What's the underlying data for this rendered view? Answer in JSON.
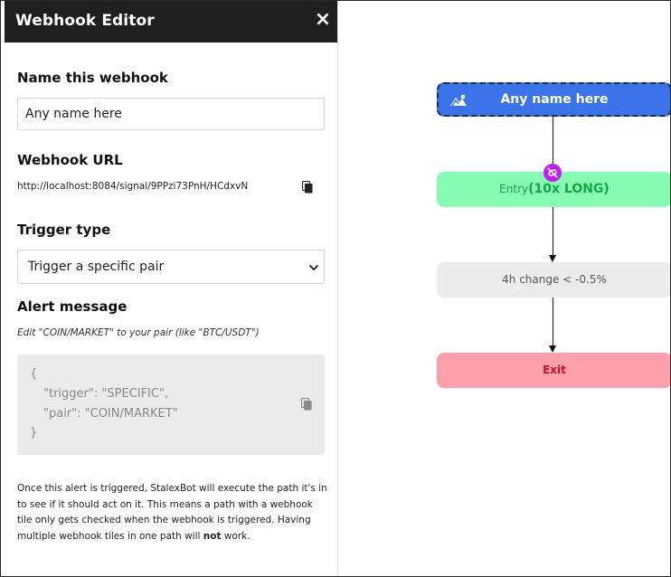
{
  "editor": {
    "title": "Webhook Editor",
    "close_label": "×",
    "name_label": "Name this webhook",
    "name_value": "Any name here",
    "url_label": "Webhook URL",
    "url_value": "http://localhost:8084/signal/9PPzi73PnH/HCdxvN",
    "trigger_label": "Trigger type",
    "trigger_value": "Trigger a specific pair",
    "alert_label": "Alert message",
    "alert_hint": "Edit \"COIN/MARKET\" to your pair (like \"BTC/USDT\")",
    "code_lines": [
      "{",
      "\"trigger\": \"SPECIFIC\",",
      "\"pair\": \"COIN/MARKET\"",
      "}"
    ],
    "help_text": "Once this alert is triggered, StalexBot will execute the path it's in to see if it should act on it. This means a path with a webhook tile only gets checked when the webhook is triggered. Having multiple webhook tiles in one path will ",
    "help_bold": "not",
    "help_end": " work."
  },
  "flow": {
    "webhook_label": "Any name here",
    "entry_prefix": "Entry",
    "entry_main": "(10x LONG)",
    "condition_label": "4h change < -0.5%",
    "exit_label": "Exit"
  },
  "icons": {
    "close": "close-icon",
    "copy": "copy-icon",
    "chevron": "chevron-down-icon",
    "webhook": "webhook-icon",
    "unlink": "unlink-icon"
  },
  "colors": {
    "header": "#1f1f1f",
    "webhook_node": "#3b74ea",
    "entry_node": "#86fbb2",
    "entry_text": "#15a44b",
    "condition_node": "#ececec",
    "exit_node": "#fca0ab",
    "exit_text": "#c2122b",
    "unlink_badge": "#c11ff0"
  }
}
